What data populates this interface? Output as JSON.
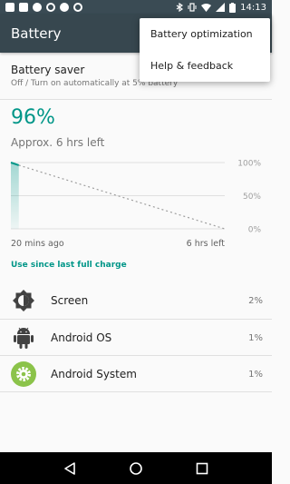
{
  "status_bar": {
    "time": "14:13",
    "left_icons": [
      "gmail-icon",
      "image-icon",
      "media-icon",
      "blocked-icon",
      "skype-icon",
      "record-icon"
    ],
    "right_icons": [
      "bluetooth-icon",
      "vibrate-icon",
      "wifi-icon",
      "signal-icon",
      "battery-icon"
    ]
  },
  "app_bar": {
    "title": "Battery"
  },
  "popup_menu": {
    "items": [
      {
        "label": "Battery optimization"
      },
      {
        "label": "Help & feedback"
      }
    ]
  },
  "battery_saver": {
    "title": "Battery saver",
    "subtitle": "Off / Turn on automatically at 5% battery"
  },
  "battery": {
    "percent": "96%",
    "time_left": "Approx. 6 hrs left"
  },
  "chart_data": {
    "type": "line",
    "x_labels": [
      "20 mins ago",
      "6 hrs left"
    ],
    "y_ticks": [
      "100%",
      "50%",
      "0%"
    ],
    "ylim": [
      0,
      100
    ],
    "series": [
      {
        "kind": "history",
        "x": [
          0,
          1
        ],
        "y": [
          100,
          96
        ]
      },
      {
        "kind": "projection",
        "x": [
          1,
          27
        ],
        "y": [
          96,
          0
        ]
      }
    ],
    "x_range": [
      0,
      27
    ],
    "grid": true,
    "accent_color": "#009688"
  },
  "usage": {
    "header": "Use since last full charge",
    "rows": [
      {
        "label": "Screen",
        "value": "2%",
        "icon": "brightness-icon"
      },
      {
        "label": "Android OS",
        "value": "1%",
        "icon": "android-icon"
      },
      {
        "label": "Android System",
        "value": "1%",
        "icon": "settings-gear-icon"
      }
    ]
  },
  "nav_bar": {
    "buttons": [
      "back-icon",
      "home-icon",
      "recents-icon"
    ]
  },
  "colors": {
    "primary": "#37474f",
    "status_bar": "#3a4b54",
    "accent": "#009688"
  }
}
